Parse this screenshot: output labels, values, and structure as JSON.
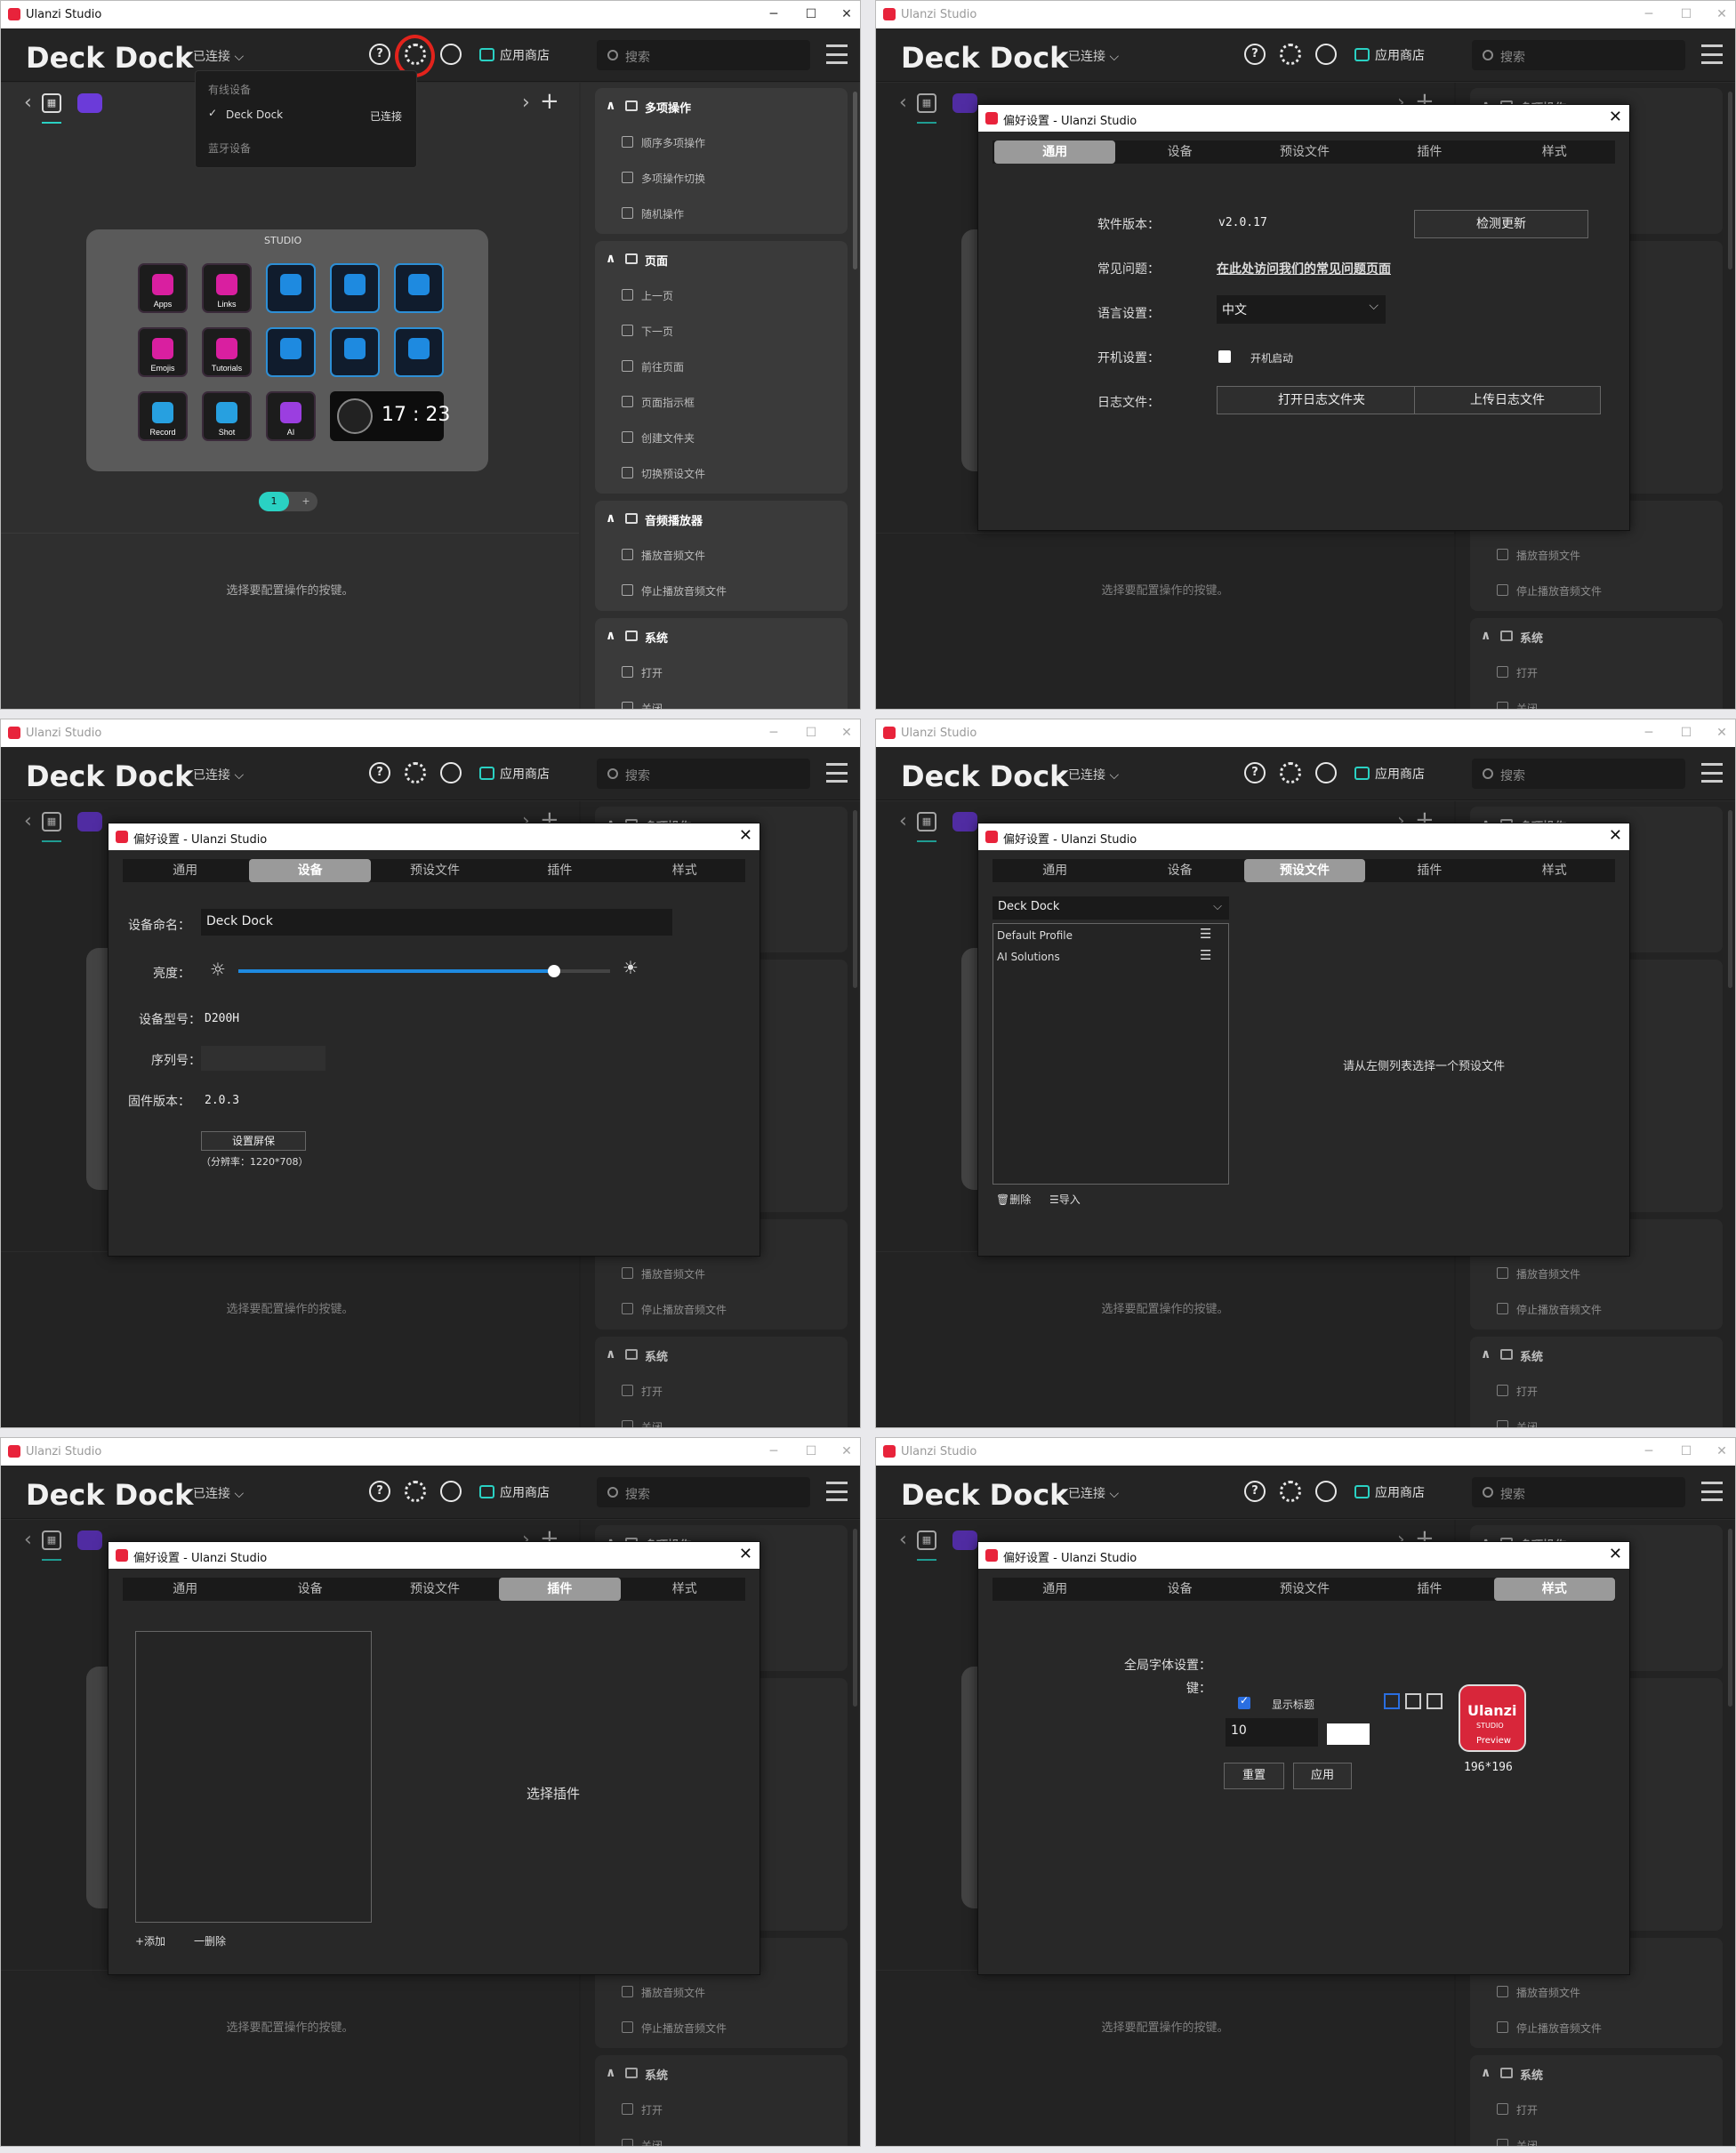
{
  "app": {
    "window_title": "Ulanzi Studio",
    "brand": "Deck Dock",
    "connection": "已连接 ⌵",
    "store": "应用商店",
    "search_placeholder": "搜索",
    "hint": "选择要配置操作的按键。",
    "win_min": "─",
    "win_max": "☐",
    "win_close": "✕",
    "icons": [
      "help-icon",
      "gear-icon",
      "profile-icon",
      "store-icon",
      "list-icon"
    ]
  },
  "device_menu": {
    "wired_header": "有线设备",
    "device_name": "Deck Dock",
    "device_status": "已连接",
    "bluetooth_header": "蓝牙设备"
  },
  "deck": {
    "studio_label": "STUDIO",
    "keys": [
      {
        "label": "Apps",
        "color": "#d91fa0"
      },
      {
        "label": "Links",
        "color": "#d91fa0"
      },
      {
        "label": "",
        "color": "#1e8ae0"
      },
      {
        "label": "",
        "color": "#1e8ae0"
      },
      {
        "label": "",
        "color": "#1e8ae0"
      },
      {
        "label": "Emojis",
        "color": "#d91fa0"
      },
      {
        "label": "Tutorials",
        "color": "#d91fa0"
      },
      {
        "label": "",
        "color": "#1e8ae0"
      },
      {
        "label": "",
        "color": "#1e8ae0"
      },
      {
        "label": "",
        "color": "#1e8ae0"
      },
      {
        "label": "Record",
        "color": "#27a0e0"
      },
      {
        "label": "Shot",
        "color": "#27a0e0"
      },
      {
        "label": "AI",
        "color": "#9b3ee0"
      }
    ],
    "clock": "17 : 23",
    "page_on": "1",
    "page_add": "+"
  },
  "actions": {
    "groups": [
      {
        "title": "多项操作",
        "items": [
          "顺序多项操作",
          "多项操作切换",
          "随机操作"
        ]
      },
      {
        "title": "页面",
        "items": [
          "上一页",
          "下一页",
          "前往页面",
          "页面指示框",
          "创建文件夹",
          "切换预设文件"
        ]
      },
      {
        "title": "音频播放器",
        "items": [
          "播放音频文件",
          "停止播放音频文件"
        ]
      },
      {
        "title": "系统",
        "items": [
          "打开",
          "关闭"
        ]
      }
    ],
    "partial_top": "多项操作"
  },
  "prefs": {
    "title": "偏好设置 - Ulanzi Studio",
    "tabs": [
      "通用",
      "设备",
      "预设文件",
      "插件",
      "样式"
    ],
    "general": {
      "version_label": "软件版本：",
      "version": "v2.0.17",
      "check_update": "检测更新",
      "faq_label": "常见问题：",
      "faq_link": "在此处访问我们的常见问题页面",
      "lang_label": "语言设置：",
      "lang": "中文",
      "startup_label": "开机设置：",
      "startup_text": "开机启动",
      "log_label": "日志文件：",
      "open_log": "打开日志文件夹",
      "upload_log": "上传日志文件"
    },
    "device": {
      "name_label": "设备命名：",
      "name": "Deck Dock",
      "brightness_label": "亮度：",
      "brightness": 0.85,
      "model_label": "设备型号：",
      "model": "D200H",
      "serial_label": "序列号：",
      "firmware_label": "固件版本：",
      "firmware": "2.0.3",
      "screensaver_btn": "设置屏保",
      "resolution": "（分辨率：1220*708）"
    },
    "profiles": {
      "device_select": "Deck Dock",
      "items": [
        "Default Profile",
        "AI Solutions"
      ],
      "delete": "删除",
      "import": "导入",
      "hint": "请从左侧列表选择一个预设文件"
    },
    "plugins": {
      "hint": "选择插件",
      "add": "+添加",
      "remove": "一删除"
    },
    "style": {
      "font_label": "全局字体设置：",
      "key_label": "键：",
      "show_title": "显示标题",
      "font_size": "10",
      "reset": "重置",
      "apply": "应用",
      "preview_brand": "Ulanzi",
      "preview_sub": "STUDIO",
      "preview_text": "Preview",
      "preview_size": "196*196"
    }
  }
}
